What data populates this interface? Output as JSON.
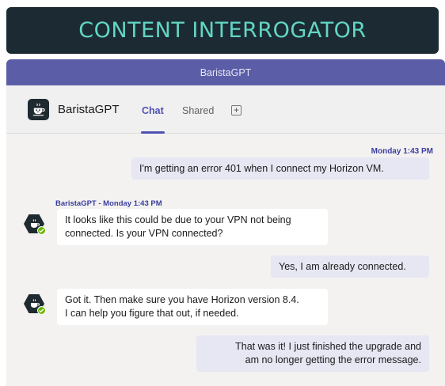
{
  "banner": {
    "title": "CONTENT INTERROGATOR"
  },
  "window": {
    "title": "BaristaGPT"
  },
  "header": {
    "bot_name": "BaristaGPT",
    "tabs": [
      {
        "label": "Chat",
        "active": true
      },
      {
        "label": "Shared",
        "active": false
      }
    ],
    "add_tab_symbol": "+"
  },
  "chat": {
    "messages": [
      {
        "sender": "user",
        "timestamp": "Monday 1:43 PM",
        "lines": [
          "I'm getting an error 401 when I connect my Horizon VM."
        ]
      },
      {
        "sender": "bot",
        "timestamp": "BaristaGPT - Monday 1:43 PM",
        "lines": [
          "It looks like this could be due to your VPN not being",
          "connected. Is your VPN connected?"
        ]
      },
      {
        "sender": "user",
        "lines": [
          "Yes, I am already connected."
        ]
      },
      {
        "sender": "bot",
        "lines": [
          "Got it. Then make sure you have Horizon version 8.4.",
          "I can help you figure that out, if needed."
        ]
      },
      {
        "sender": "user",
        "lines": [
          "That was it! I just finished the upgrade and",
          "am no longer getting the error message."
        ]
      }
    ]
  },
  "colors": {
    "banner_bg": "#1c2b33",
    "banner_text": "#62d6c4",
    "titlebar": "#5b5ea6",
    "accent": "#4f52b2",
    "user_bubble": "#e6e7f3",
    "bot_bubble": "#ffffff",
    "presence": "#6bb700"
  },
  "icons": {
    "bot_avatar": "coffee-cup-icon",
    "presence": "available-check-icon",
    "add_tab": "add-tab-icon"
  }
}
